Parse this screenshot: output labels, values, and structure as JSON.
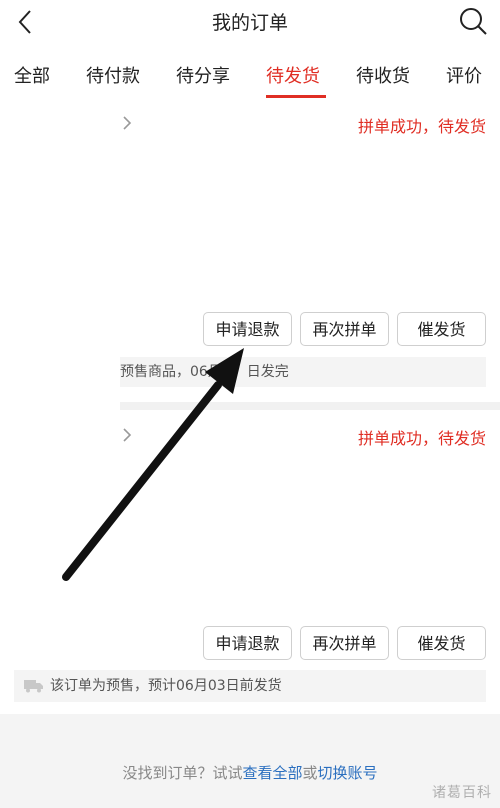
{
  "header": {
    "title": "我的订单"
  },
  "tabs": [
    {
      "label": "全部"
    },
    {
      "label": "待付款"
    },
    {
      "label": "待分享"
    },
    {
      "label": "待发货",
      "active": true
    },
    {
      "label": "待收货"
    },
    {
      "label": "评价"
    }
  ],
  "orders": [
    {
      "status": "拼单成功，待发货",
      "buttons": {
        "refund": "申请退款",
        "regroup": "再次拼单",
        "remind": "催发货"
      },
      "note": "预售商品，06月0",
      "note_tail": "日发完"
    },
    {
      "status": "拼单成功，待发货",
      "buttons": {
        "refund": "申请退款",
        "regroup": "再次拼单",
        "remind": "催发货"
      },
      "note": "该订单为预售，预计06月03日前发货"
    }
  ],
  "footer": {
    "tip_prefix": "没找到订单？试试",
    "link_all": "查看全部",
    "or": "或",
    "link_switch": "切换账号"
  },
  "watermark": "诸葛百科",
  "colors": {
    "accent": "#e02e24",
    "link": "#2b6fbf"
  }
}
